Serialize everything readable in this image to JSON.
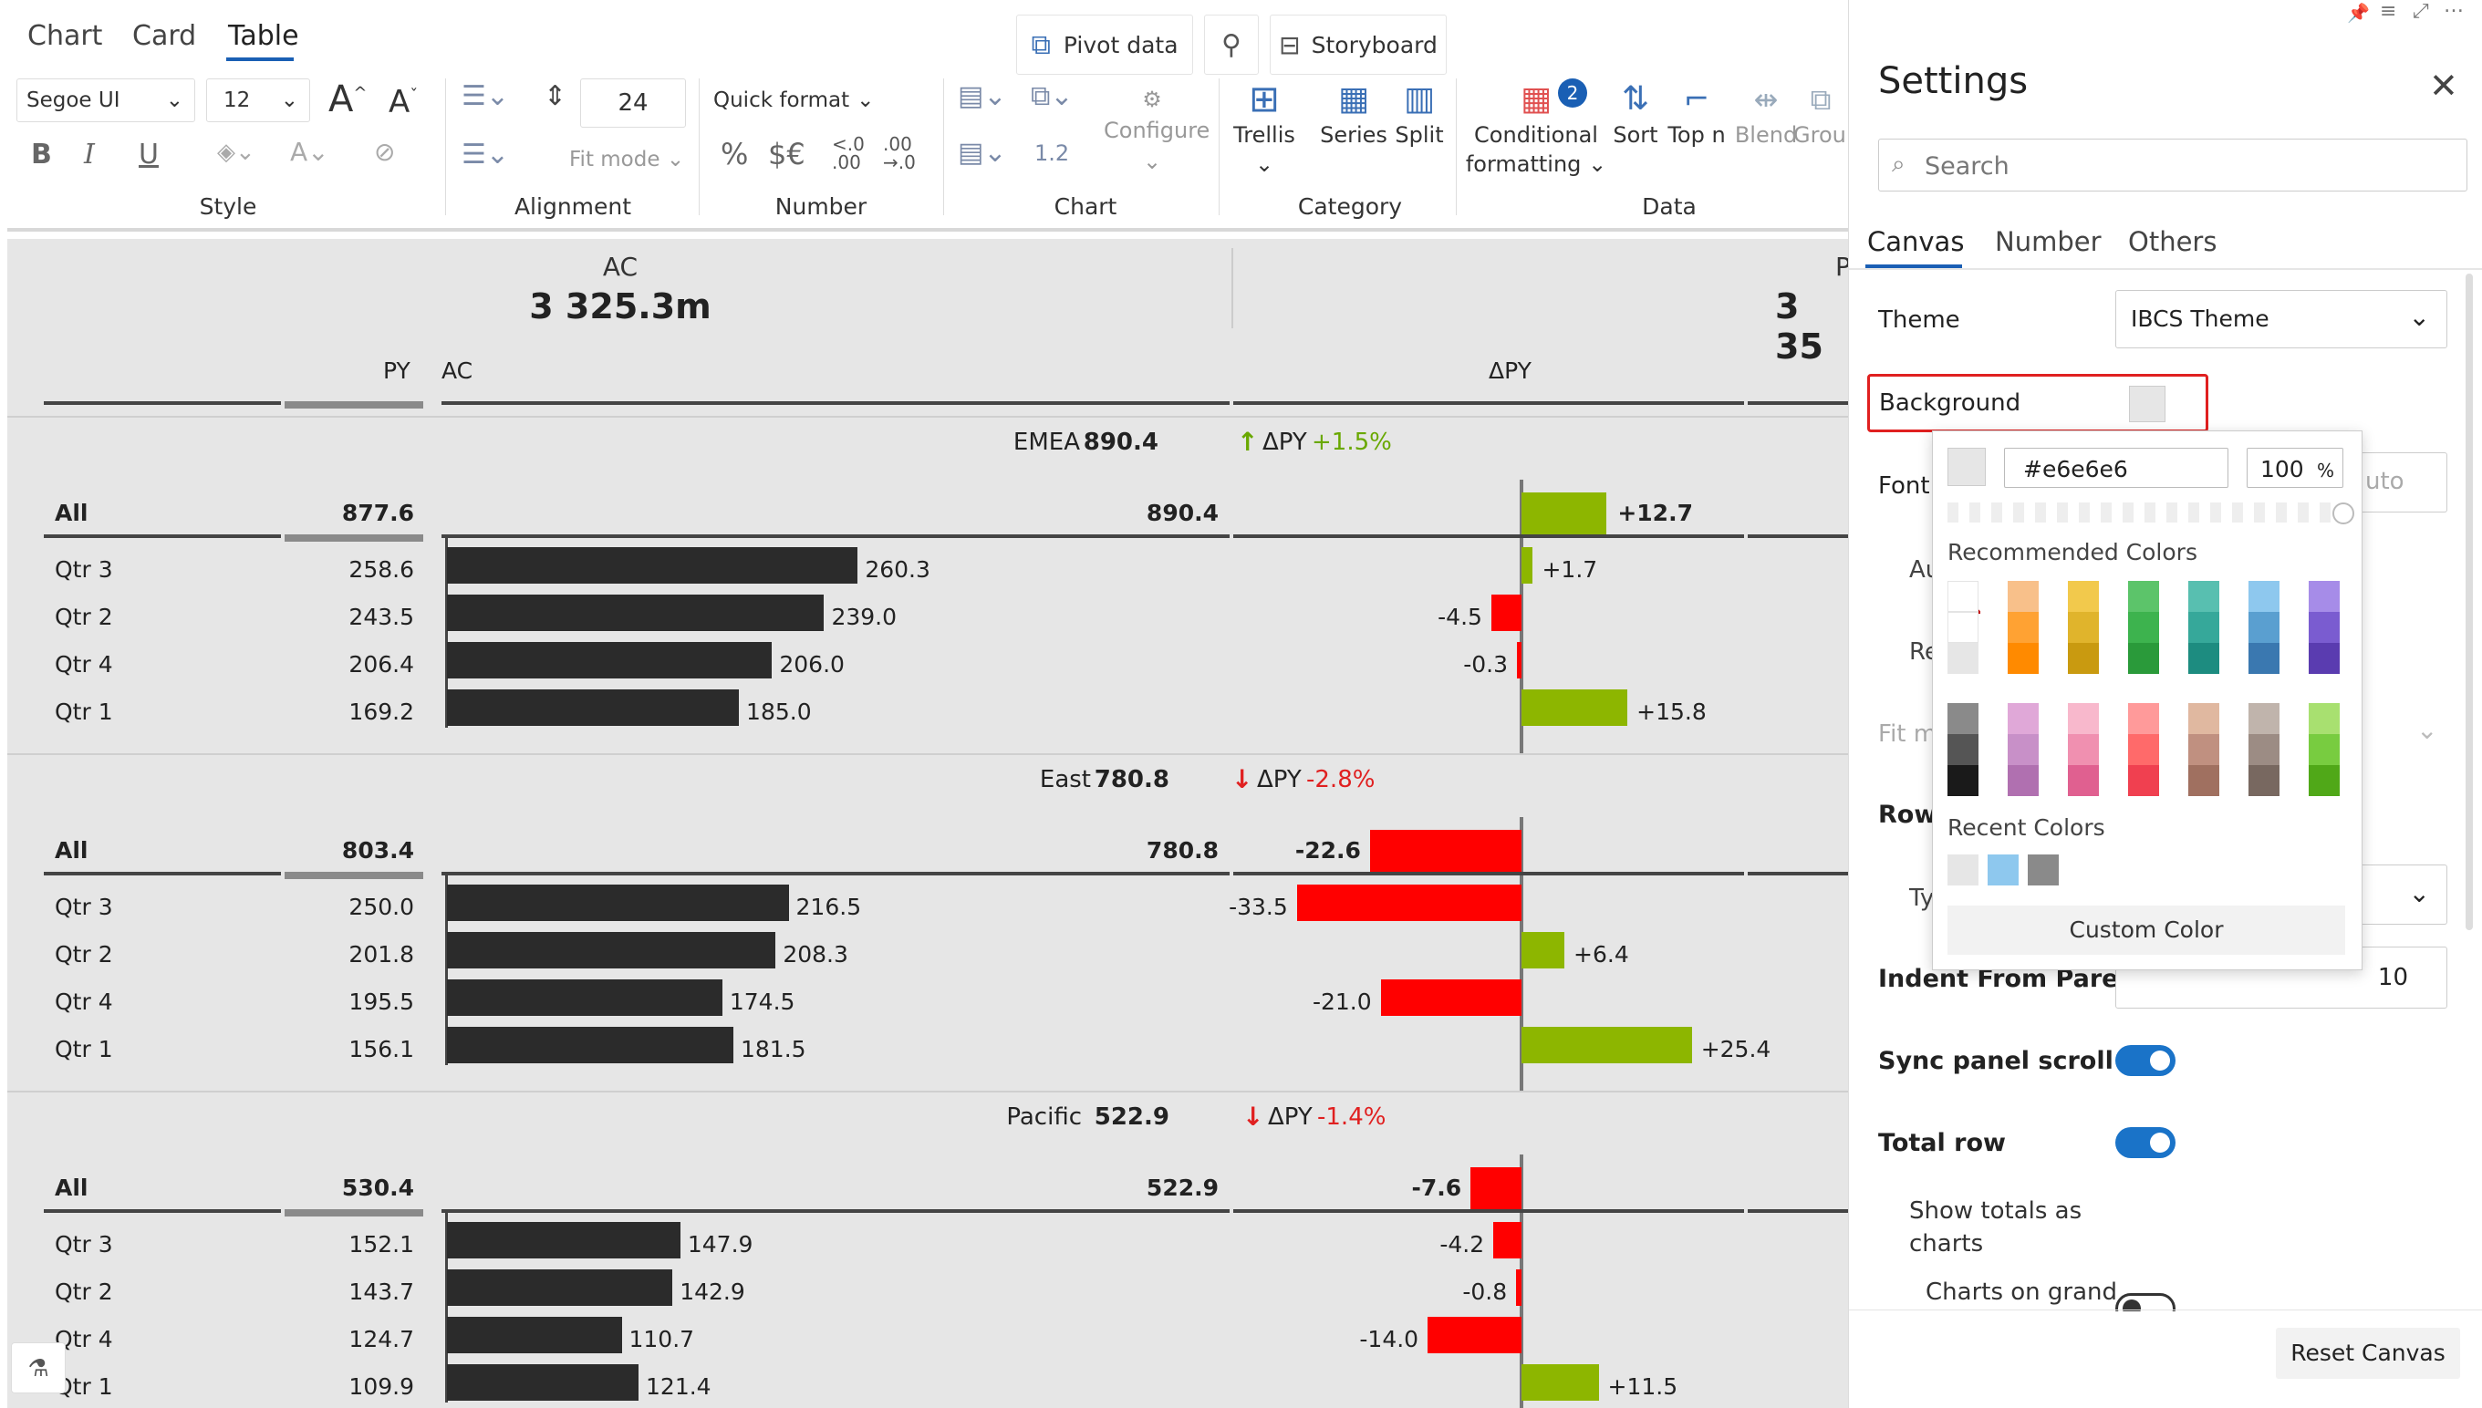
{
  "tabs": [
    {
      "label": "Chart"
    },
    {
      "label": "Card"
    },
    {
      "label": "Table"
    }
  ],
  "toolbar": {
    "pivot_label": "Pivot data",
    "storyboard_label": "Storyboard",
    "font_family": "Segoe UI",
    "font_size": "12",
    "row_height": "24",
    "fit_mode": "Fit mode",
    "quick_format": "Quick format",
    "pct": "%",
    "currency": "$€",
    "chart_value": "1.2",
    "configure": "Configure",
    "trellis": "Trellis",
    "series": "Series",
    "split": "Split",
    "cond_fmt_1": "Conditional",
    "cond_fmt_2": "formatting",
    "cond_badge": "2",
    "sort": "Sort",
    "topn": "Top n",
    "blend": "Blend",
    "group": "Grou",
    "groups": [
      "Style",
      "Alignment",
      "Number",
      "Chart",
      "Category",
      "Data"
    ]
  },
  "table": {
    "ac_header": "AC",
    "ac_total": "3 325.3m",
    "py_header_partial": "P",
    "py_total_partial": "3 35",
    "col_py": "PY",
    "col_ac": "AC",
    "col_dpy": "ΔPY",
    "sections": [
      {
        "name": "EMEA",
        "value": "890.4",
        "arrow": "↑",
        "dlabel": "ΔPY",
        "pct": "+1.5%",
        "trend": "up",
        "all": {
          "label": "All",
          "py": "877.6",
          "ac": "890.4",
          "delta": "+12.7",
          "dv": 12.7
        },
        "rows": [
          {
            "label": "Qtr 3",
            "py": "258.6",
            "ac": "260.3",
            "acv": 260.3,
            "delta": "+1.7",
            "dv": 1.7
          },
          {
            "label": "Qtr 2",
            "py": "243.5",
            "ac": "239.0",
            "acv": 239.0,
            "delta": "-4.5",
            "dv": -4.5
          },
          {
            "label": "Qtr 4",
            "py": "206.4",
            "ac": "206.0",
            "acv": 206.0,
            "delta": "-0.3",
            "dv": -0.3
          },
          {
            "label": "Qtr 1",
            "py": "169.2",
            "ac": "185.0",
            "acv": 185.0,
            "delta": "+15.8",
            "dv": 15.8
          }
        ]
      },
      {
        "name": "East",
        "value": "780.8",
        "arrow": "↓",
        "dlabel": "ΔPY",
        "pct": "-2.8%",
        "trend": "down",
        "all": {
          "label": "All",
          "py": "803.4",
          "ac": "780.8",
          "delta": "-22.6",
          "dv": -22.6
        },
        "rows": [
          {
            "label": "Qtr 3",
            "py": "250.0",
            "ac": "216.5",
            "acv": 216.5,
            "delta": "-33.5",
            "dv": -33.5
          },
          {
            "label": "Qtr 2",
            "py": "201.8",
            "ac": "208.3",
            "acv": 208.3,
            "delta": "+6.4",
            "dv": 6.4
          },
          {
            "label": "Qtr 4",
            "py": "195.5",
            "ac": "174.5",
            "acv": 174.5,
            "delta": "-21.0",
            "dv": -21.0
          },
          {
            "label": "Qtr 1",
            "py": "156.1",
            "ac": "181.5",
            "acv": 181.5,
            "delta": "+25.4",
            "dv": 25.4
          }
        ]
      },
      {
        "name": "Pacific",
        "value": "522.9",
        "arrow": "↓",
        "dlabel": "ΔPY",
        "pct": "-1.4%",
        "trend": "down",
        "all": {
          "label": "All",
          "py": "530.4",
          "ac": "522.9",
          "delta": "-7.6",
          "dv": -7.6
        },
        "rows": [
          {
            "label": "Qtr 3",
            "py": "152.1",
            "ac": "147.9",
            "acv": 147.9,
            "delta": "-4.2",
            "dv": -4.2
          },
          {
            "label": "Qtr 2",
            "py": "143.7",
            "ac": "142.9",
            "acv": 142.9,
            "delta": "-0.8",
            "dv": -0.8
          },
          {
            "label": "Qtr 4",
            "py": "124.7",
            "ac": "110.7",
            "acv": 110.7,
            "delta": "-14.0",
            "dv": -14.0
          },
          {
            "label": "Qtr 1",
            "py": "109.9",
            "ac": "121.4",
            "acv": 121.4,
            "delta": "+11.5",
            "dv": 11.5
          }
        ]
      }
    ]
  },
  "settings": {
    "title": "Settings",
    "search_placeholder": "Search",
    "tabs": [
      "Canvas",
      "Number",
      "Others"
    ],
    "theme_label": "Theme",
    "theme_value": "IBCS Theme",
    "background_label": "Background",
    "font_label_partial": "Font",
    "font_value_partial": "uto",
    "au_partial": "Au",
    "re_partial": "Re",
    "fitm_partial": "Fit m",
    "row_partial": "Row",
    "ty_partial": "Ty",
    "indent_label": "Indent From Parent",
    "indent_value": "10",
    "sync_label": "Sync panel scroll",
    "total_row_label": "Total row",
    "show_totals_1": "Show totals as",
    "show_totals_2": "charts",
    "charts_grand": "Charts on grand",
    "reset_label": "Reset Canvas"
  },
  "color_picker": {
    "hex": "#e6e6e6",
    "opacity": "100",
    "pct": "%",
    "recommended_label": "Recommended Colors",
    "recent_label": "Recent Colors",
    "custom_label": "Custom Color",
    "row1": [
      [
        "#ffffff",
        "#ffffff",
        "#e6e6e6"
      ],
      [
        "#f8c08a",
        "#ffa233",
        "#ff8a00"
      ],
      [
        "#f2c94c",
        "#e0b42c",
        "#c99a10"
      ],
      [
        "#5cc46a",
        "#3db34e",
        "#2a9a3a"
      ],
      [
        "#58bfb0",
        "#36a89a",
        "#1d8c80"
      ],
      [
        "#8ec8ee",
        "#5a9fd0",
        "#3a78b0"
      ],
      [
        "#a68ce8",
        "#7a5cd0",
        "#5a3cb0"
      ]
    ],
    "row2": [
      [
        "#8a8a8a",
        "#555555",
        "#1a1a1a"
      ],
      [
        "#e0a8d8",
        "#c890c8",
        "#b070b0"
      ],
      [
        "#f8b8cc",
        "#f090b0",
        "#e06090"
      ],
      [
        "#ff9a9a",
        "#ff6a6a",
        "#f04050"
      ],
      [
        "#e0b8a0",
        "#c09080",
        "#a07060"
      ],
      [
        "#c0b4ac",
        "#9c8c84",
        "#786860"
      ],
      [
        "#a8e070",
        "#78cc40",
        "#50a818"
      ]
    ],
    "recent": [
      "#e6e6e6",
      "#8ec8ee",
      "#8a8a8a"
    ]
  }
}
